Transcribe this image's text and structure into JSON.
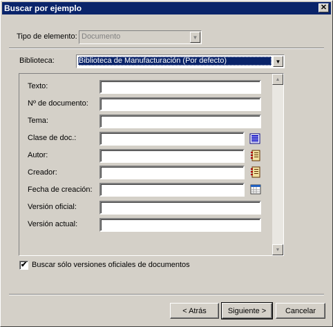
{
  "window": {
    "title": "Buscar por ejemplo",
    "close_glyph": "✕"
  },
  "tipo": {
    "label": "Tipo de elemento:",
    "value": "Documento"
  },
  "biblioteca": {
    "label": "Biblioteca:",
    "value": "Biblioteca de Manufacturación (Por defecto)"
  },
  "fields": [
    {
      "label": "Texto:",
      "value": ""
    },
    {
      "label": "Nº de documento:",
      "value": ""
    },
    {
      "label": "Tema:",
      "value": ""
    },
    {
      "label": "Clase de doc.:",
      "value": "",
      "icon": "list-icon"
    },
    {
      "label": "Autor:",
      "value": "",
      "icon": "address-book-icon"
    },
    {
      "label": "Creador:",
      "value": "",
      "icon": "address-book-icon"
    },
    {
      "label": "Fecha de creación:",
      "value": "",
      "icon": "calendar-icon"
    },
    {
      "label": "Versión oficial:",
      "value": ""
    },
    {
      "label": "Versión actual:",
      "value": ""
    }
  ],
  "checkbox": {
    "label": "Buscar sólo versiones oficiales de documentos",
    "checked": true,
    "mark": "✔"
  },
  "buttons": {
    "back": "< Atrás",
    "next": "Siguiente >",
    "cancel": "Cancelar"
  }
}
